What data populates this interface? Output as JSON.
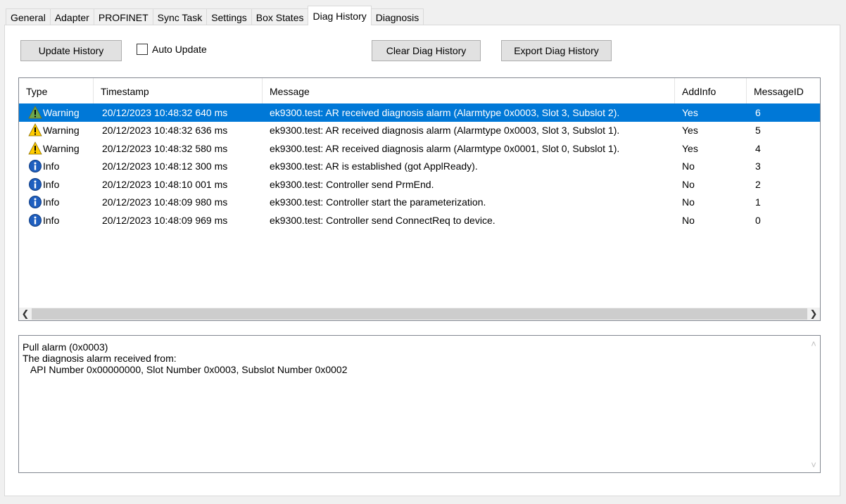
{
  "tabs": [
    {
      "label": "General"
    },
    {
      "label": "Adapter"
    },
    {
      "label": "PROFINET"
    },
    {
      "label": "Sync Task"
    },
    {
      "label": "Settings"
    },
    {
      "label": "Box States"
    },
    {
      "label": "Diag History"
    },
    {
      "label": "Diagnosis"
    }
  ],
  "toolbar": {
    "update_label": "Update History",
    "auto_update_label": "Auto Update",
    "clear_label": "Clear Diag History",
    "export_label": "Export Diag History"
  },
  "list": {
    "columns": [
      "Type",
      "Timestamp",
      "Message",
      "AddInfo",
      "MessageID"
    ],
    "rows": [
      {
        "type": "Warning",
        "icon": "warning-icon",
        "timestamp": "20/12/2023 10:48:32 640 ms",
        "message": "ek9300.test: AR received diagnosis alarm (Alarmtype 0x0003, Slot 3, Subslot 2).",
        "addinfo": "Yes",
        "id": "6",
        "selected": true
      },
      {
        "type": "Warning",
        "icon": "warning-icon",
        "timestamp": "20/12/2023 10:48:32 636 ms",
        "message": "ek9300.test: AR received diagnosis alarm (Alarmtype 0x0003, Slot 3, Subslot 1).",
        "addinfo": "Yes",
        "id": "5",
        "selected": false
      },
      {
        "type": "Warning",
        "icon": "warning-icon",
        "timestamp": "20/12/2023 10:48:32 580 ms",
        "message": "ek9300.test: AR received diagnosis alarm (Alarmtype 0x0001, Slot 0, Subslot 1).",
        "addinfo": "Yes",
        "id": "4",
        "selected": false
      },
      {
        "type": "Info",
        "icon": "info-icon",
        "timestamp": "20/12/2023 10:48:12 300 ms",
        "message": "ek9300.test: AR is established (got ApplReady).",
        "addinfo": "No",
        "id": "3",
        "selected": false
      },
      {
        "type": "Info",
        "icon": "info-icon",
        "timestamp": "20/12/2023 10:48:10 001 ms",
        "message": "ek9300.test: Controller send PrmEnd.",
        "addinfo": "No",
        "id": "2",
        "selected": false
      },
      {
        "type": "Info",
        "icon": "info-icon",
        "timestamp": "20/12/2023 10:48:09 980 ms",
        "message": "ek9300.test: Controller start the parameterization.",
        "addinfo": "No",
        "id": "1",
        "selected": false
      },
      {
        "type": "Info",
        "icon": "info-icon",
        "timestamp": "20/12/2023 10:48:09 969 ms",
        "message": "ek9300.test: Controller send ConnectReq to device.",
        "addinfo": "No",
        "id": "0",
        "selected": false
      }
    ]
  },
  "detail": {
    "line1": "Pull alarm (0x0003)",
    "line2": "The diagnosis alarm received from:",
    "line3": "   API Number 0x00000000, Slot Number 0x0003, Subslot Number 0x0002"
  },
  "colors": {
    "selection": "#0078d7",
    "warning": "#ffcc00",
    "info": "#1f5fbf"
  }
}
